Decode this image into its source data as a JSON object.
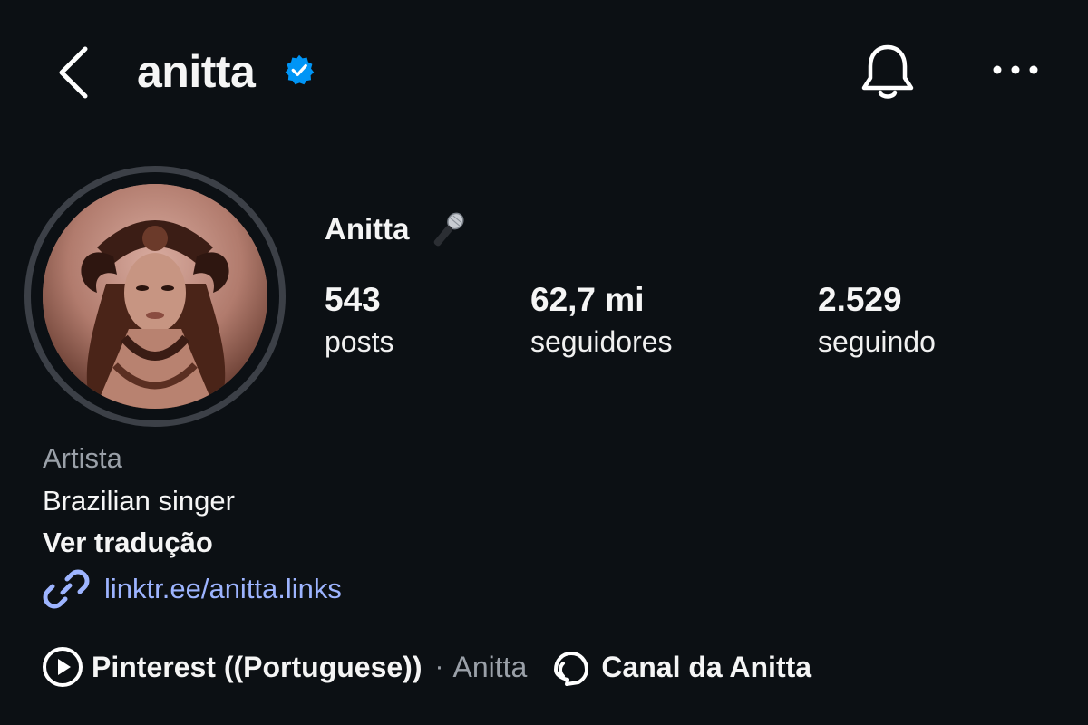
{
  "header": {
    "username": "anitta",
    "verified": true,
    "icons": [
      "chevron-left-icon",
      "verified-badge-icon",
      "bell-icon",
      "more-horizontal-icon"
    ]
  },
  "profile": {
    "display_name": "Anitta",
    "name_emoji": "microphone-icon",
    "stats": {
      "posts": {
        "value": "543",
        "label": "posts"
      },
      "followers": {
        "value": "62,7 mi",
        "label": "seguidores"
      },
      "following": {
        "value": "2.529",
        "label": "seguindo"
      }
    }
  },
  "bio": {
    "category": "Artista",
    "text": "Brazilian singer",
    "translate_label": "Ver tradução",
    "link": "linktr.ee/anitta.links"
  },
  "footer": {
    "music_label": "Pinterest ((Portuguese))",
    "separator": "·",
    "music_artist": "Anitta",
    "channel_label": "Canal da Anitta"
  },
  "colors": {
    "background": "#0c1014",
    "verified_blue": "#0095f6",
    "link_blue": "#9db4ff",
    "secondary_text": "#9aa0a8",
    "avatar_ring": "#3c4047"
  }
}
